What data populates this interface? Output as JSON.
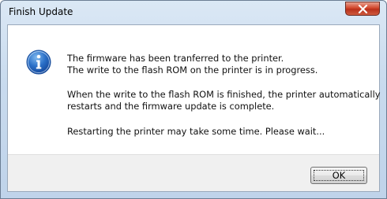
{
  "window": {
    "title": "Finish Update",
    "close_icon": "close-x-icon"
  },
  "dialog": {
    "icon": "information-icon",
    "messages": [
      "The firmware has been tranferred to the printer.",
      "The write to the flash ROM on the printer is in progress.",
      "When the write to the flash ROM is finished, the printer automatically",
      "restarts and the firmware update is complete.",
      "Restarting the printer may take some time. Please wait..."
    ]
  },
  "buttons": {
    "ok_label": "OK"
  },
  "colors": {
    "info_blue": "#2a6fc7",
    "close_red": "#c8452d",
    "frame": "#c9dbee",
    "footer": "#f0f0f0"
  }
}
